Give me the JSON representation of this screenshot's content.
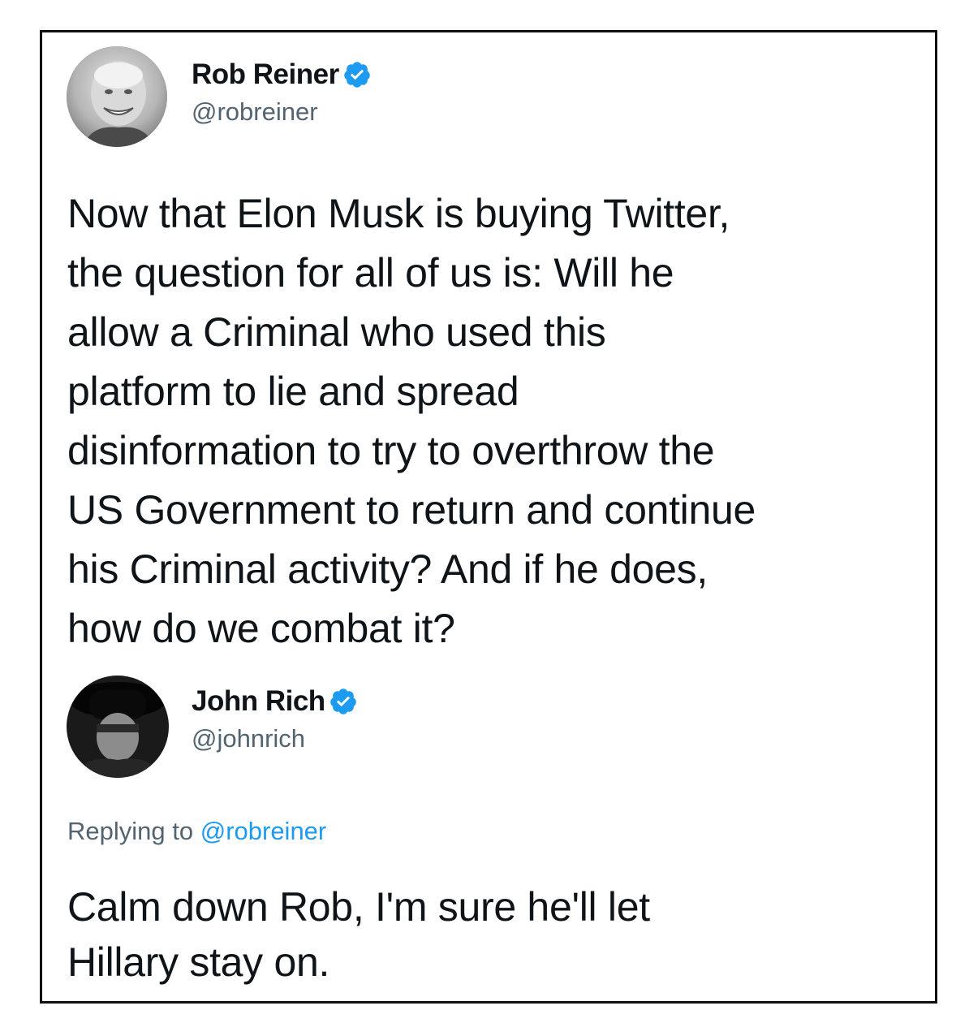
{
  "tweet1": {
    "display_name": "Rob Reiner",
    "handle": "@robreiner",
    "avatar_icon": "person-avatar-icon",
    "lines": [
      "Now that Elon Musk is buying Twitter,",
      "the question for all of us is: Will he",
      "allow a Criminal who used this",
      "platform to lie and spread",
      "disinformation to try to overthrow the",
      "US Government to return and continue",
      "his Criminal activity? And if he does,",
      "how do we combat it?"
    ]
  },
  "tweet2": {
    "display_name": "John Rich",
    "handle": "@johnrich",
    "avatar_icon": "person-avatar-icon",
    "replying_prefix": "Replying to ",
    "replying_handle": "@robreiner",
    "lines": [
      "Calm down Rob, I'm sure he'll let",
      "Hillary stay on."
    ]
  },
  "colors": {
    "verified_badge": "#1d9bf0",
    "secondary_text": "#536471",
    "link": "#1d9bf0",
    "primary_text": "#0f1419"
  }
}
